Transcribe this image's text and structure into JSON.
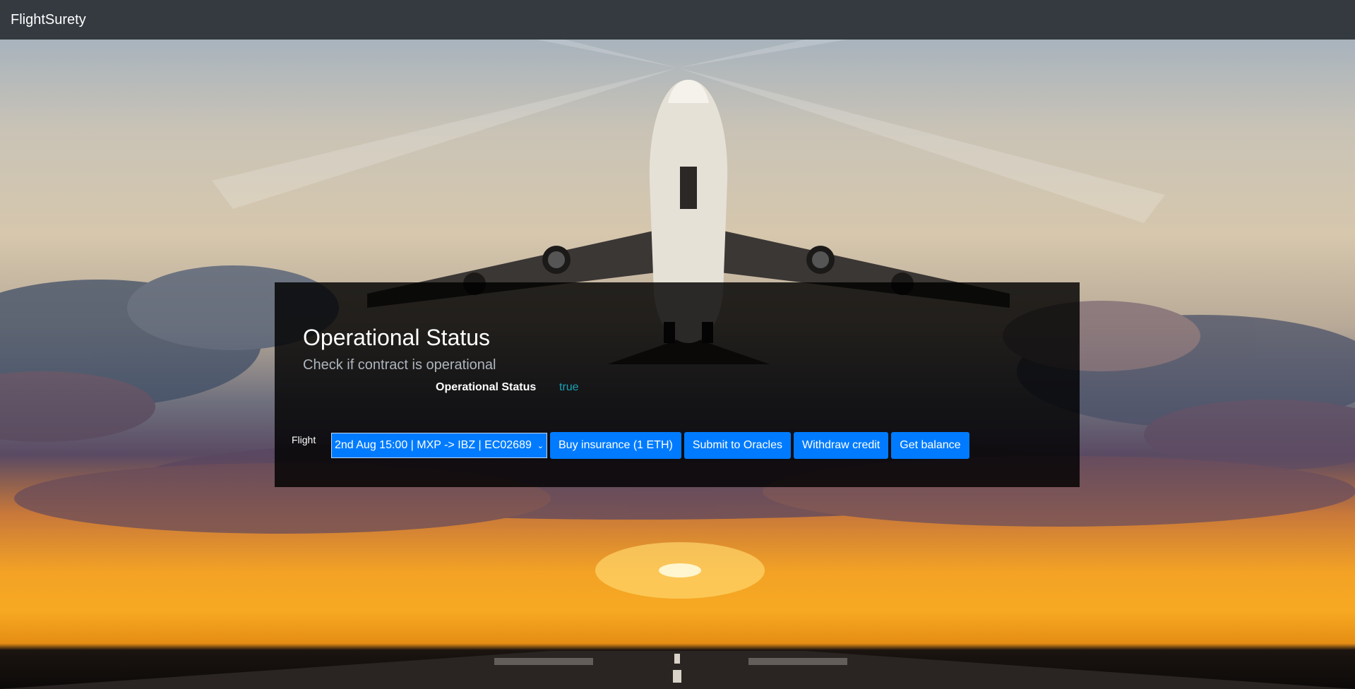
{
  "navbar": {
    "brand": "FlightSurety"
  },
  "panel": {
    "title": "Operational Status",
    "subtitle": "Check if contract is operational",
    "status_label": "Operational Status",
    "status_value": "true"
  },
  "controls": {
    "flight_label": "Flight",
    "flight_selected": "2nd Aug 15:00 | MXP -> IBZ | EC02689",
    "buttons": {
      "buy_insurance": "Buy insurance (1 ETH)",
      "submit_oracles": "Submit to Oracles",
      "withdraw_credit": "Withdraw credit",
      "get_balance": "Get balance"
    }
  },
  "colors": {
    "navbar": "#343a40",
    "primary": "#007bff",
    "status_value": "#17a2b8"
  },
  "icons": {
    "select_chevron": "chevron-down-icon"
  }
}
